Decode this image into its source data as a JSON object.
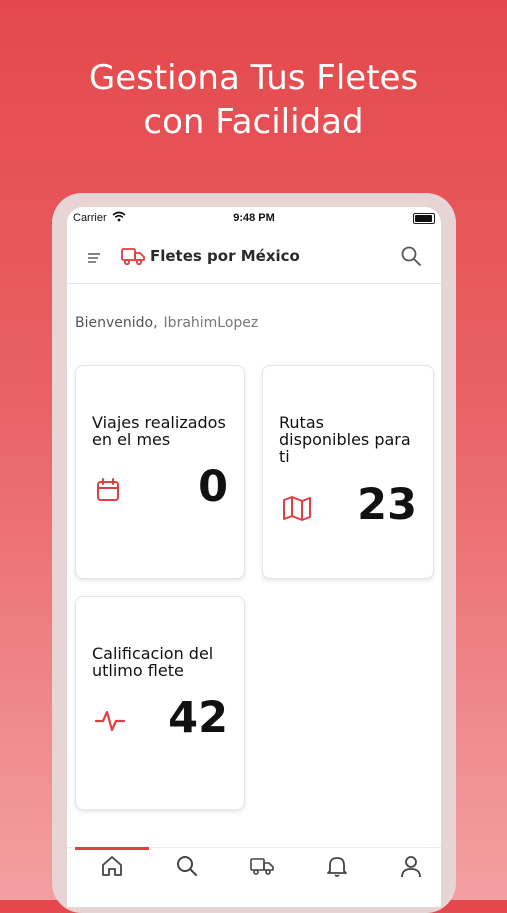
{
  "headline": {
    "line1": "Gestiona Tus Fletes",
    "line2": "con Facilidad"
  },
  "statusbar": {
    "carrier": "Carrier",
    "time": "9:48 PM"
  },
  "navbar": {
    "title": "Fletes por México"
  },
  "welcome": {
    "greeting": "Bienvenido,",
    "username": "IbrahimLopez"
  },
  "cards": [
    {
      "label_lines": [
        "Viajes realizados",
        "en el mes"
      ],
      "value": "0",
      "icon": "calendar-icon"
    },
    {
      "label_lines": [
        "Rutas",
        "disponibles para",
        "ti"
      ],
      "value": "23",
      "icon": "map-icon"
    },
    {
      "label_lines": [
        "Calificacion del",
        "utlimo flete"
      ],
      "value": "42",
      "icon": "activity-icon"
    }
  ],
  "tabs": [
    "home-icon",
    "search-icon",
    "truck-icon",
    "bell-icon",
    "user-icon"
  ],
  "colors": {
    "accent": "#e23d3f",
    "background_top": "#e4484c",
    "background_bottom": "#f3a0a2"
  }
}
